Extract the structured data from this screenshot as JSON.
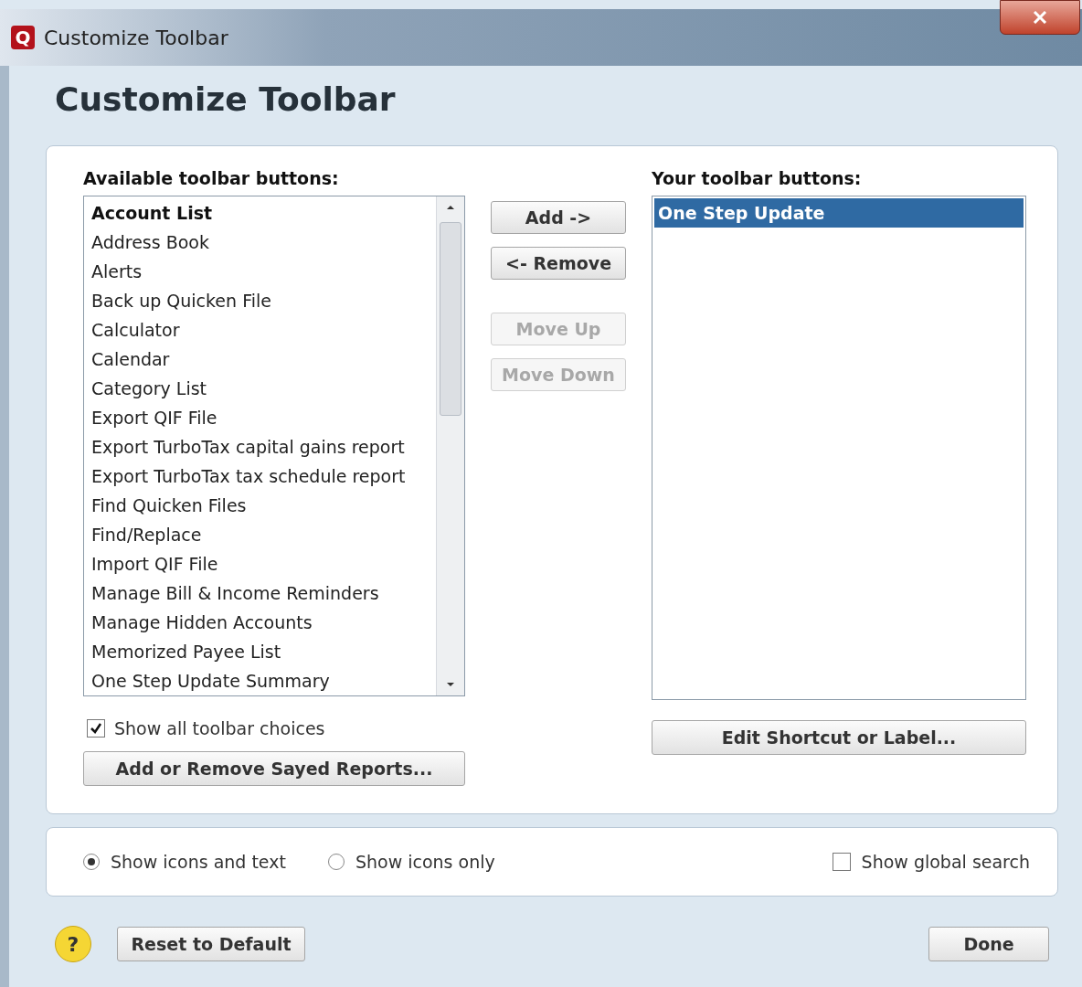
{
  "window": {
    "logo": "Q",
    "title": "Customize Toolbar"
  },
  "heading": "Customize Toolbar",
  "available": {
    "label": "Available toolbar buttons:",
    "items": [
      {
        "label": "Account List",
        "selected": true
      },
      {
        "label": "Address Book",
        "selected": false
      },
      {
        "label": "Alerts",
        "selected": false
      },
      {
        "label": "Back up Quicken File",
        "selected": false
      },
      {
        "label": "Calculator",
        "selected": false
      },
      {
        "label": "Calendar",
        "selected": false
      },
      {
        "label": "Category List",
        "selected": false
      },
      {
        "label": "Export QIF File",
        "selected": false
      },
      {
        "label": "Export TurboTax capital gains report",
        "selected": false
      },
      {
        "label": "Export TurboTax tax schedule report",
        "selected": false
      },
      {
        "label": "Find Quicken Files",
        "selected": false
      },
      {
        "label": "Find/Replace",
        "selected": false
      },
      {
        "label": "Import QIF File",
        "selected": false
      },
      {
        "label": "Manage Bill & Income Reminders",
        "selected": false
      },
      {
        "label": "Manage Hidden Accounts",
        "selected": false
      },
      {
        "label": "Memorized Payee List",
        "selected": false
      },
      {
        "label": "One Step Update Summary",
        "selected": false
      }
    ]
  },
  "middle_buttons": [
    {
      "label": "Add ->",
      "disabled": false
    },
    {
      "label": "<- Remove",
      "disabled": false
    },
    {
      "label": "Move Up",
      "disabled": true
    },
    {
      "label": "Move Down",
      "disabled": true
    }
  ],
  "yours": {
    "label": "Your toolbar buttons:",
    "items": [
      {
        "label": "One Step Update",
        "selected": true
      }
    ]
  },
  "show_all": {
    "label": "Show all toolbar choices",
    "checked": true
  },
  "saved_reports_button": "Add or Remove Sayed Reports...",
  "edit_button": "Edit Shortcut or Label...",
  "display_options": [
    {
      "label": "Show icons and text",
      "selected": true
    },
    {
      "label": "Show icons only",
      "selected": false
    }
  ],
  "global_search": {
    "label": "Show global search",
    "checked": false
  },
  "help": "?",
  "reset_button": "Reset to Default",
  "done_button": "Done"
}
